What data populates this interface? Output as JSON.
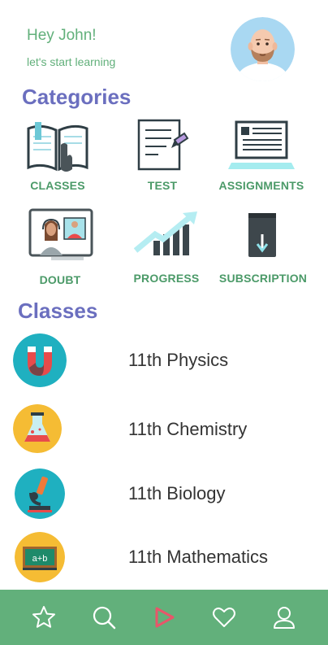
{
  "header": {
    "greeting": "Hey John!",
    "subtitle": "let's start learning",
    "avatar_icon": "user-avatar"
  },
  "categories": {
    "title": "Categories",
    "items": [
      {
        "label": "CLASSES",
        "icon": "open-book-icon"
      },
      {
        "label": "TEST",
        "icon": "test-paper-icon"
      },
      {
        "label": "ASSIGNMENTS",
        "icon": "laptop-document-icon"
      },
      {
        "label": "DOUBT",
        "icon": "video-call-icon"
      },
      {
        "label": "PROGRESS",
        "icon": "growth-chart-icon"
      },
      {
        "label": "SUBSCRIPTION",
        "icon": "book-download-icon"
      }
    ]
  },
  "classes": {
    "title": "Classes",
    "items": [
      {
        "name": "11th Physics",
        "icon": "magnet-icon"
      },
      {
        "name": "11th Chemistry",
        "icon": "flask-icon"
      },
      {
        "name": "11th Biology",
        "icon": "microscope-icon"
      },
      {
        "name": "11th Mathematics",
        "icon": "blackboard-icon"
      }
    ]
  },
  "bottom_nav": {
    "items": [
      "star-icon",
      "search-icon",
      "play-icon",
      "heart-icon",
      "user-icon"
    ],
    "active_color": "#e8566a",
    "bar_color": "#62b07b"
  },
  "colors": {
    "accent_green": "#62b07b",
    "heading_purple": "#6b6fbf"
  }
}
